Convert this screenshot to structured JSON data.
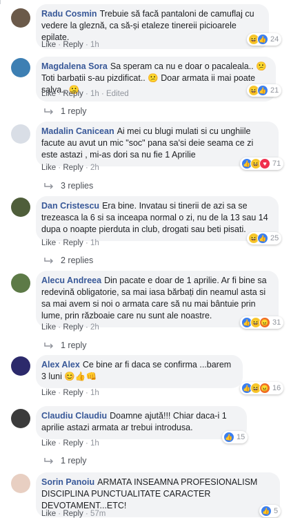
{
  "comments": [
    {
      "author": "Radu Cosmin",
      "text": "Trebuie să facă pantaloni de camuflaj cu vedere la gleznă, ca să-și etaleze tinereii picioarele epilate.",
      "actions": {
        "like": "Like",
        "reply": "Reply",
        "time": "1h",
        "edited": ""
      },
      "reactions": {
        "types": [
          "haha",
          "like"
        ],
        "count": "24"
      },
      "replies": ""
    },
    {
      "author": "Magdalena Sora",
      "text": "Sa speram ca nu e doar o pacaleala.. 😕 Toti barbatii s-au pizdificat.. 😕 Doar armata ii mai poate salva.. 😕",
      "actions": {
        "like": "Like",
        "reply": "Reply",
        "time": "1h",
        "edited": "Edited"
      },
      "reactions": {
        "types": [
          "haha",
          "like"
        ],
        "count": "21"
      },
      "replies": "1 reply"
    },
    {
      "author": "Madalin Canicean",
      "text": "Ai mei cu blugi mulati si cu unghiile facute au avut un mic \"soc\" pana sa'si deie seama ce zi este astazi , mi-as dori sa nu fie 1 Aprilie",
      "actions": {
        "like": "Like",
        "reply": "Reply",
        "time": "2h",
        "edited": ""
      },
      "reactions": {
        "types": [
          "like",
          "haha",
          "love"
        ],
        "count": "71"
      },
      "replies": "3 replies"
    },
    {
      "author": "Dan Cristescu",
      "text": "Era bine. Invatau si tinerii de azi sa se trezeasca la 6 si sa inceapa normal o zi, nu de la 13 sau 14 dupa o noapte pierduta in club, drogati sau beti pisati.",
      "actions": {
        "like": "Like",
        "reply": "Reply",
        "time": "1h",
        "edited": ""
      },
      "reactions": {
        "types": [
          "haha",
          "like"
        ],
        "count": "25"
      },
      "replies": "2 replies"
    },
    {
      "author": "Alecu Andreea",
      "text": "Din pacate e doar de 1 aprilie. Ar fi bine sa redevină obligatorie, sa mai iasa bărbați din neamul asta si sa mai avem si noi o armata care să nu mai bântuie prin lume, prin războaie care nu sunt ale noastre.",
      "actions": {
        "like": "Like",
        "reply": "Reply",
        "time": "2h",
        "edited": ""
      },
      "reactions": {
        "types": [
          "like",
          "haha",
          "angry"
        ],
        "count": "31"
      },
      "replies": "1 reply"
    },
    {
      "author": "Alex Alex",
      "text": "Ce bine ar fi daca se confirma ...barem 3 luni 😊👍👊",
      "actions": {
        "like": "Like",
        "reply": "Reply",
        "time": "1h",
        "edited": ""
      },
      "reactions": {
        "types": [
          "like",
          "haha",
          "angry"
        ],
        "count": "16"
      },
      "replies": ""
    },
    {
      "author": "Claudiu Claudiu",
      "text": "Doamne ajută!!! Chiar daca-i 1 aprilie astazi armata ar trebui introdusa.",
      "actions": {
        "like": "Like",
        "reply": "Reply",
        "time": "1h",
        "edited": ""
      },
      "reactions": {
        "types": [
          "like"
        ],
        "count": "15"
      },
      "replies": "1 reply"
    },
    {
      "author": "Sorin Panoiu",
      "text": "ARMATA INSEAMNA PROFESIONALISM DISCIPLINA PUNCTUALITATE CARACTER DEVOTAMENT...ETC!",
      "actions": {
        "like": "Like",
        "reply": "Reply",
        "time": "57m",
        "edited": ""
      },
      "reactions": {
        "types": [
          "like"
        ],
        "count": "5"
      },
      "replies": ""
    }
  ],
  "colors": {
    "author": "#385898",
    "bubble": "#f2f3f5",
    "meta": "#90949c"
  }
}
